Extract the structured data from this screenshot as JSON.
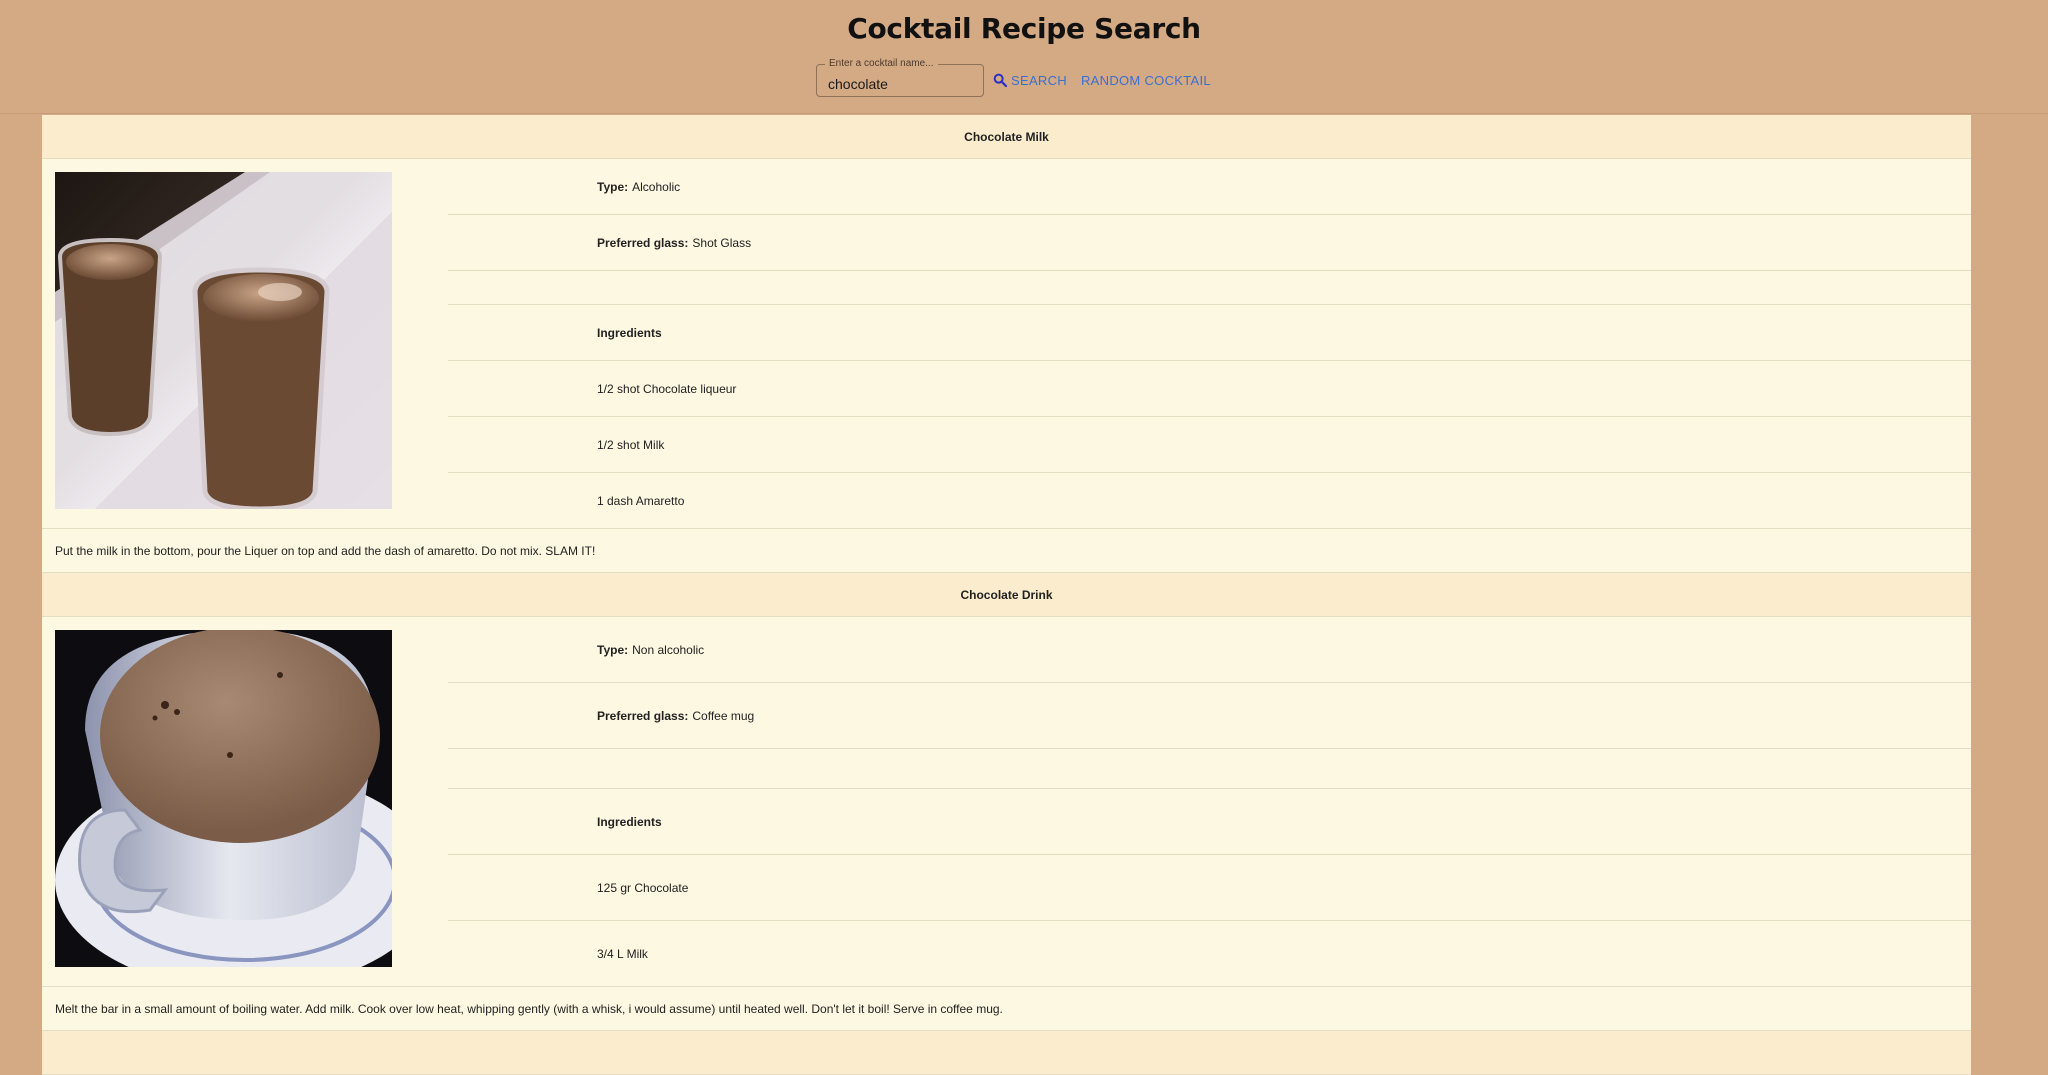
{
  "app": {
    "title": "Cocktail Recipe Search"
  },
  "search": {
    "label": "Enter a cocktail name...",
    "value": "chocolate",
    "search_button": "Search",
    "random_button": "Random Cocktail",
    "accent_color": "#3b6fcf"
  },
  "recipes": [
    {
      "name": "Chocolate Milk",
      "type_label": "Type:",
      "type": "Alcoholic",
      "glass_label": "Preferred glass:",
      "glass": "Shot Glass",
      "ingredients_heading": "Ingredients",
      "ingredients": [
        "1/2 shot Chocolate liqueur",
        "1/2 shot Milk",
        "1 dash Amaretto"
      ],
      "instructions": "Put the milk in the bottom, pour the Liquer on top and add the dash of amaretto. Do not mix. SLAM IT!"
    },
    {
      "name": "Chocolate Drink",
      "type_label": "Type:",
      "type": "Non alcoholic",
      "glass_label": "Preferred glass:",
      "glass": "Coffee mug",
      "ingredients_heading": "Ingredients",
      "ingredients": [
        "125 gr Chocolate",
        "3/4 L Milk"
      ],
      "instructions": "Melt the bar in a small amount of boiling water. Add milk. Cook over low heat, whipping gently (with a whisk, i would assume) until heated well. Don't let it boil! Serve in coffee mug."
    }
  ]
}
